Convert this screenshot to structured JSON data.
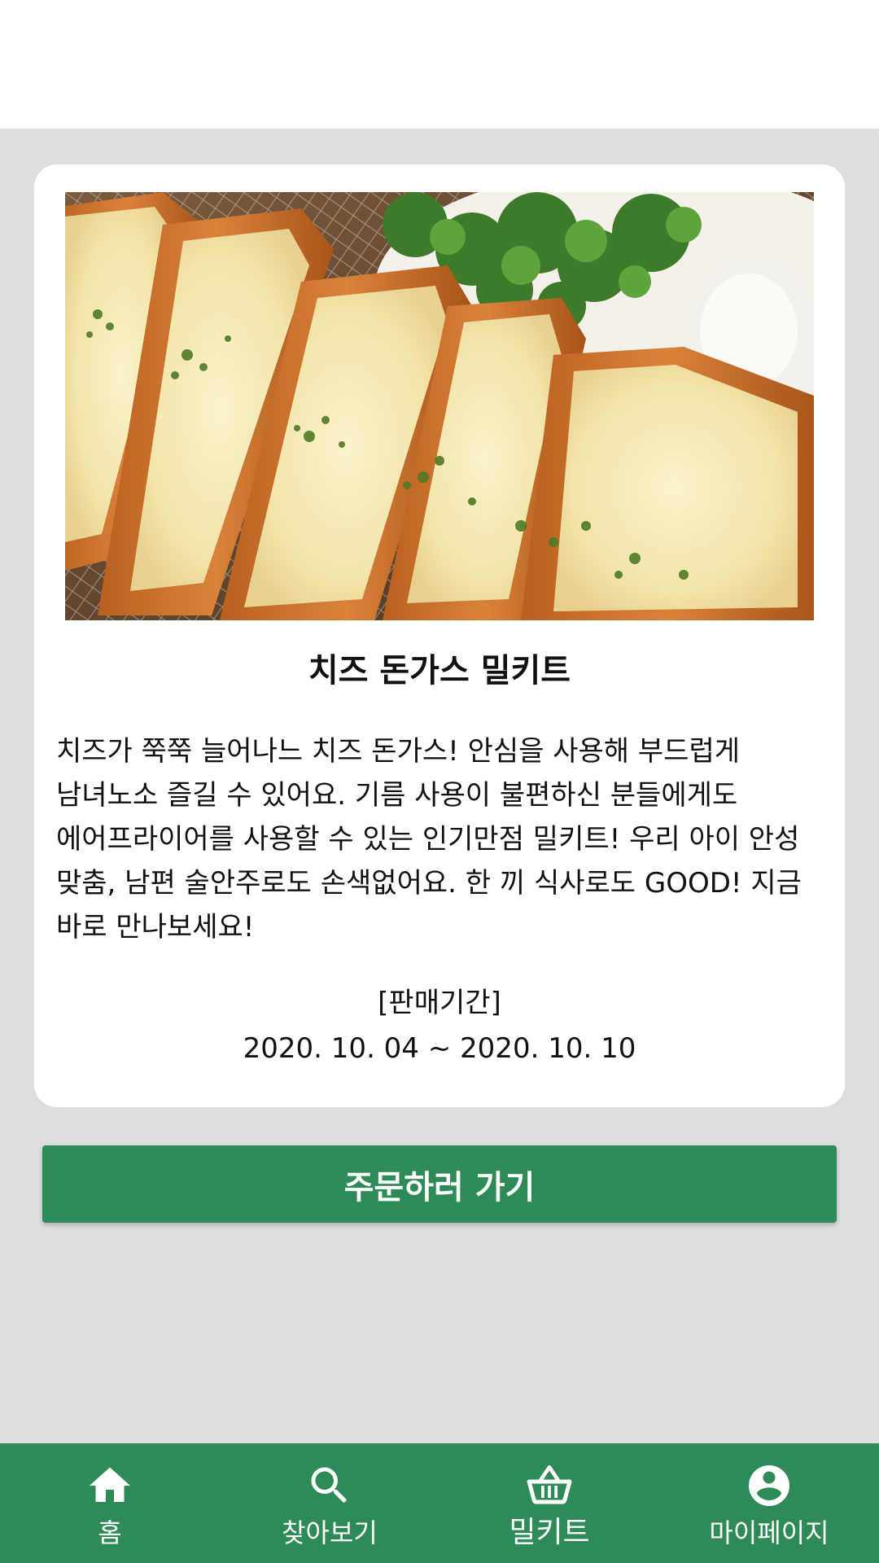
{
  "product": {
    "title": "치즈 돈가스 밀키트",
    "description": "치즈가 쭉쭉 늘어나느 치즈 돈가스! 안심을 사용해 부드럽게 남녀노소 즐길 수 있어요. 기름 사용이 불편하신 분들에게도 에어프라이어를 사용할 수 있는 인기만점 밀키트! 우리 아이 안성 맞춤, 남편 술안주로도 손색없어요. 한 끼 식사로도 GOOD! 지금 바로 만나보세요!",
    "sale_label": "[판매기간]",
    "sale_period": "2020. 10. 04 ~ 2020. 10. 10"
  },
  "order_button": {
    "label": "주문하러 가기"
  },
  "bottom_nav": {
    "items": [
      {
        "label": "홈",
        "icon": "home-icon"
      },
      {
        "label": "찾아보기",
        "icon": "search-icon"
      },
      {
        "label": "밀키트",
        "icon": "basket-icon"
      },
      {
        "label": "마이페이지",
        "icon": "account-icon"
      }
    ]
  },
  "colors": {
    "primary": "#2e8b57",
    "background": "#dcdfdd",
    "card": "#ffffff"
  }
}
